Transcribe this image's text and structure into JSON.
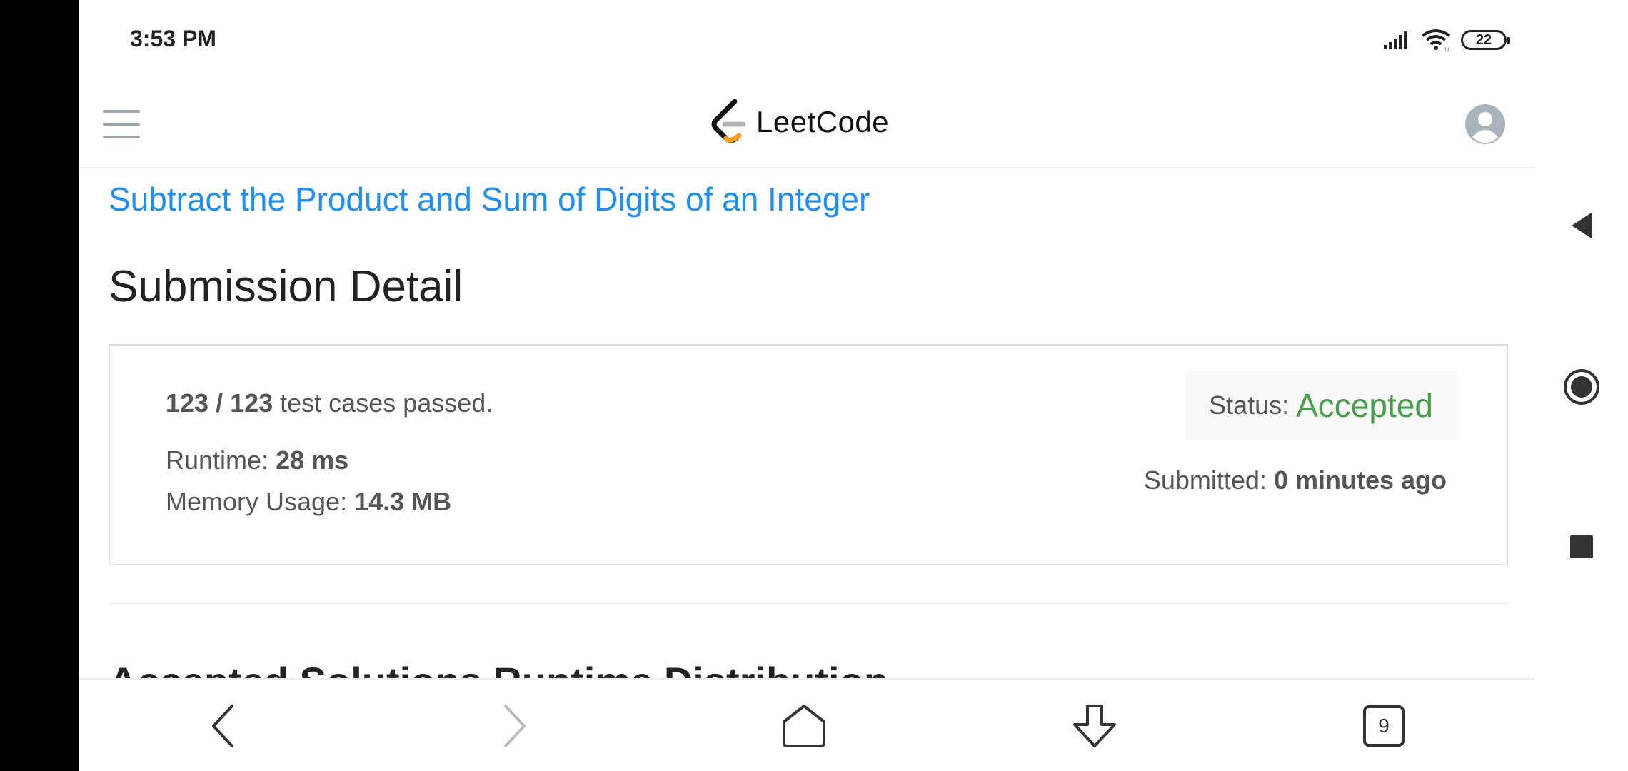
{
  "status_bar": {
    "time": "3:53 PM",
    "battery": "22",
    "icons": [
      "signal-icon",
      "wifi-icon",
      "battery-icon"
    ]
  },
  "header": {
    "logo_text": "LeetCode",
    "menu_icon": "hamburger-icon",
    "avatar_icon": "user-avatar-icon"
  },
  "problem": {
    "title": "Subtract the Product and Sum of Digits of an Integer"
  },
  "page": {
    "title": "Submission Detail"
  },
  "submission": {
    "passed_count": "123 / 123",
    "passed_suffix": " test cases passed.",
    "runtime_label": "Runtime: ",
    "runtime_value": "28 ms",
    "memory_label": "Memory Usage: ",
    "memory_value": "14.3 MB",
    "status_label": "Status:",
    "status_value": "Accepted",
    "submitted_label": "Submitted: ",
    "submitted_value": "0 minutes ago"
  },
  "next_section": {
    "heading": "Accepted Solutions Runtime Distribution"
  },
  "toolbar": {
    "tabs_count": "9",
    "icons": [
      "back-icon",
      "forward-icon",
      "home-icon",
      "download-icon",
      "tabs-icon"
    ]
  },
  "colors": {
    "link": "#1a90ff",
    "accepted": "#43a047",
    "text": "#555555",
    "heading": "#222222"
  }
}
